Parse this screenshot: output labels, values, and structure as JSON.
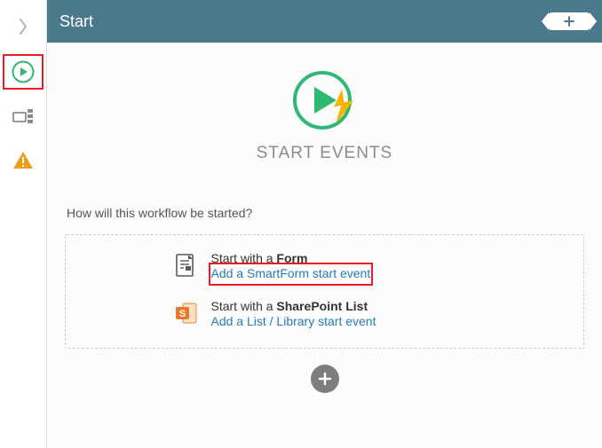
{
  "header": {
    "title": "Start"
  },
  "section": {
    "title": "START EVENTS",
    "question": "How will this workflow be started?"
  },
  "options": [
    {
      "prefix": "Start with a ",
      "bold": "Form",
      "link": "Add a SmartForm start event"
    },
    {
      "prefix": "Start with a ",
      "bold": "SharePoint List",
      "link": "Add a List / Library start event"
    }
  ]
}
